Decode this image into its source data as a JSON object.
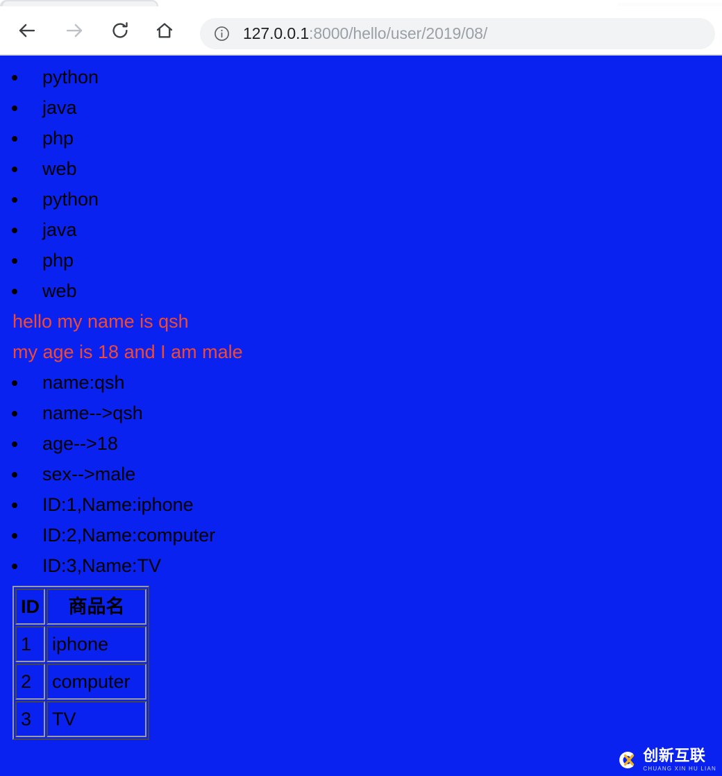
{
  "browser": {
    "toolbar": {
      "back_icon": "back-arrow-icon",
      "forward_icon": "forward-arrow-icon",
      "reload_icon": "reload-icon",
      "home_icon": "home-icon"
    },
    "address_bar": {
      "site_info_icon": "info-circle-icon",
      "url_host": "127.0.0.1",
      "url_path": ":8000/hello/user/2019/08/",
      "full_url": "127.0.0.1:8000/hello/user/2019/08/"
    }
  },
  "page": {
    "background_color": "#0A22F0",
    "text_color": "#000000",
    "paragraph_color": "#F04A32",
    "list_one": [
      "python",
      "java",
      "php",
      "web",
      "python",
      "java",
      "php",
      "web"
    ],
    "paragraphs": [
      "hello my name is qsh",
      "my age is 18 and I am male"
    ],
    "list_two": [
      "name:qsh",
      "name-->qsh",
      "age-->18",
      "sex-->male",
      "ID:1,Name:iphone",
      "ID:2,Name:computer",
      "ID:3,Name:TV"
    ],
    "table": {
      "headers": [
        "ID",
        "商品名"
      ],
      "rows": [
        [
          "1",
          "iphone"
        ],
        [
          "2",
          "computer"
        ],
        [
          "3",
          "TV"
        ]
      ]
    }
  },
  "watermark": {
    "logo_icon": "cx-circle-logo-icon",
    "name_cn": "创新互联",
    "name_pinyin": "CHUANG XIN HU LIAN",
    "accent_color": "#F2B21C"
  }
}
